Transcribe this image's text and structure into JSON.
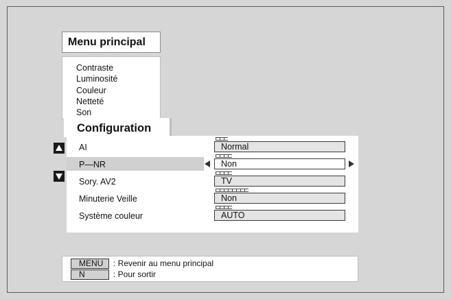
{
  "menu": {
    "title": "Menu principal",
    "items": [
      {
        "label": "Contraste"
      },
      {
        "label": "Luminosité"
      },
      {
        "label": "Couleur"
      },
      {
        "label": "Netteté"
      },
      {
        "label": "Son"
      }
    ],
    "active_tab": "Configuration"
  },
  "configuration": {
    "rows": [
      {
        "label": "AI",
        "value": "Normal",
        "options_count": 3
      },
      {
        "label": "P—NR",
        "value": "Non",
        "options_count": 4,
        "selected": true
      },
      {
        "label": "Sory. AV2",
        "value": "TV",
        "options_count": 4
      },
      {
        "label": "Minuterie Veille",
        "value": "Non",
        "options_count": 7
      },
      {
        "label": "Système couleur",
        "value": "AUTO",
        "options_count": 4
      }
    ]
  },
  "help": [
    {
      "key": "MENU",
      "text": ": Revenir au menu principal"
    },
    {
      "key": "N",
      "text": ": Pour sortir"
    }
  ],
  "colors": {
    "background": "#d6d6d6",
    "panel": "#ffffff",
    "highlight": "#d0d0d0",
    "value_box": "#e4e4e4"
  }
}
